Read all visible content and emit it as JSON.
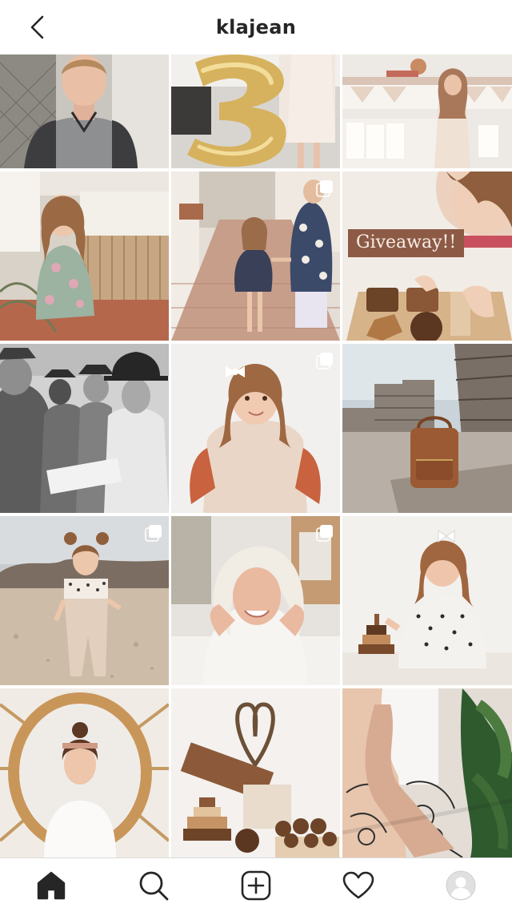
{
  "header": {
    "username": "klajean",
    "back_icon": "chevron-left-icon"
  },
  "grid": {
    "posts": [
      {
        "subject": "boy-portrait",
        "multi": false
      },
      {
        "subject": "gold-balloon-3",
        "multi": false
      },
      {
        "subject": "party-girl",
        "multi": false
      },
      {
        "subject": "girl-porch",
        "multi": false
      },
      {
        "subject": "kids-walking",
        "multi": true
      },
      {
        "subject": "giveaway-puzzle",
        "multi": false,
        "caption": "Giveaway!!"
      },
      {
        "subject": "military-photo",
        "multi": false
      },
      {
        "subject": "girl-bow",
        "multi": true
      },
      {
        "subject": "backpack-lumber",
        "multi": false
      },
      {
        "subject": "toddler-field",
        "multi": true
      },
      {
        "subject": "grandma-smile",
        "multi": true
      },
      {
        "subject": "girl-stacking",
        "multi": false
      },
      {
        "subject": "mirror-woman",
        "multi": false
      },
      {
        "subject": "sloss-toys",
        "multi": false
      },
      {
        "subject": "tattoo-arm",
        "multi": false
      }
    ]
  },
  "tabbar": {
    "items": [
      {
        "icon": "home-icon",
        "active": true
      },
      {
        "icon": "search-icon",
        "active": false
      },
      {
        "icon": "add-post-icon",
        "active": false
      },
      {
        "icon": "heart-icon",
        "active": false
      },
      {
        "icon": "profile-avatar-icon",
        "active": false
      }
    ]
  },
  "colors": {
    "text": "#262626",
    "giveaway_bg": "#8d5a45",
    "divider": "#dbdbdb"
  }
}
